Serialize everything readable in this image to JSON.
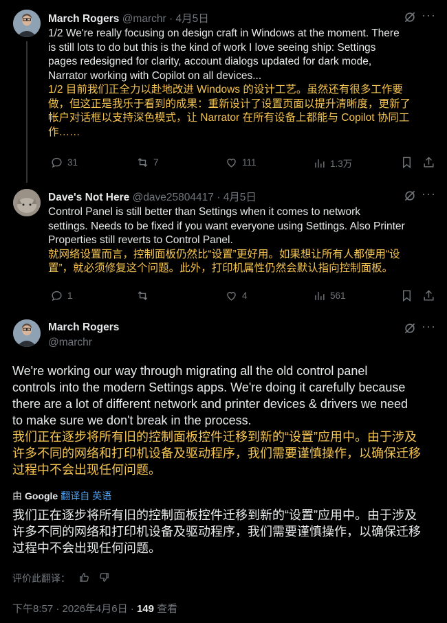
{
  "post1": {
    "name": "March Rogers",
    "handle": "@marchr",
    "date": "4月5日",
    "text_lines": [
      "1/2 We're really focusing on design craft in Windows at the moment. There",
      "is still lots to do but this is the kind of work I love seeing ship: Settings",
      "pages redesigned for clarity, account dialogs updated for dark mode,",
      "Narrator working with Copilot on all devices..."
    ],
    "translation_lines": [
      "1/2 目前我们正全力以赴地改进 Windows 的设计工艺。虽然还有很多工作要",
      "做，但这正是我乐于看到的成果：重新设计了设置页面以提升清晰度，更新了",
      "帐户对话框以支持深色模式，让 Narrator 在所有设备上都能与 Copilot 协同工",
      "作……"
    ],
    "replies": "31",
    "reposts": "7",
    "likes": "111",
    "views": "1.3万"
  },
  "post2": {
    "name": "Dave's Not Here",
    "handle": "@dave25804417",
    "date": "4月5日",
    "text_lines": [
      "Control Panel is still better than Settings when it comes to network",
      "settings. Needs to be fixed if you want everyone using Settings. Also Printer",
      "Properties still reverts to Control Panel."
    ],
    "translation_lines": [
      "就网络设置而言，控制面板仍然比“设置”更好用。如果想让所有人都使用“设",
      "置”，就必须修复这个问题。此外，打印机属性仍然会默认指向控制面板。"
    ],
    "replies": "1",
    "reposts": "",
    "likes": "4",
    "views": "561"
  },
  "main": {
    "name": "March Rogers",
    "handle": "@marchr",
    "text_lines": [
      "We're working our way through migrating all the old control panel",
      "controls into the modern Settings apps. We're doing it carefully because",
      "there are a lot of different network and printer devices & drivers we need",
      "to make sure we don't break in the process."
    ],
    "translation_lines": [
      "我们正在逐步将所有旧的控制面板控件迁移到新的“设置”应用中。由于涉及",
      "许多不同的网络和打印机设备及驱动程序，我们需要谨慎操作，以确保迁移",
      "过程中不会出现任何问题。"
    ],
    "google_prefix": "由",
    "google_brand": "Google",
    "google_link": "翻译自 英语",
    "google_translation_lines": [
      "我们正在逐步将所有旧的控制面板控件迁移到新的“设置”应用中。由于涉及",
      "许多不同的网络和打印机设备及驱动程序，我们需要谨慎操作，以确保迁移",
      "过程中不会出现任何问题。"
    ],
    "rate_label": "评价此翻译：",
    "time": "下午8:57",
    "date": "2026年4月6日",
    "views_count": "149",
    "views_label": "查看"
  }
}
